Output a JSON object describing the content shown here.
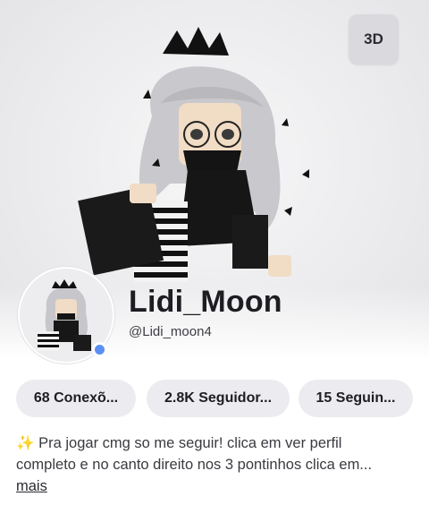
{
  "header": {
    "view_3d_label": "3D"
  },
  "profile": {
    "display_name": "Lidi_Moon",
    "username": "@Lidi_moon4",
    "status_color": "#5c8ff2"
  },
  "stats": {
    "connections": "68 Conexõ...",
    "followers": "2.8K Seguidor...",
    "following": "15 Seguin..."
  },
  "bio": {
    "line1": "✨ Pra jogar cmg so me seguir! clica em ver perfil",
    "line2": "completo e no canto direito nos 3 pontinhos clica em...",
    "more_link": "mais"
  }
}
